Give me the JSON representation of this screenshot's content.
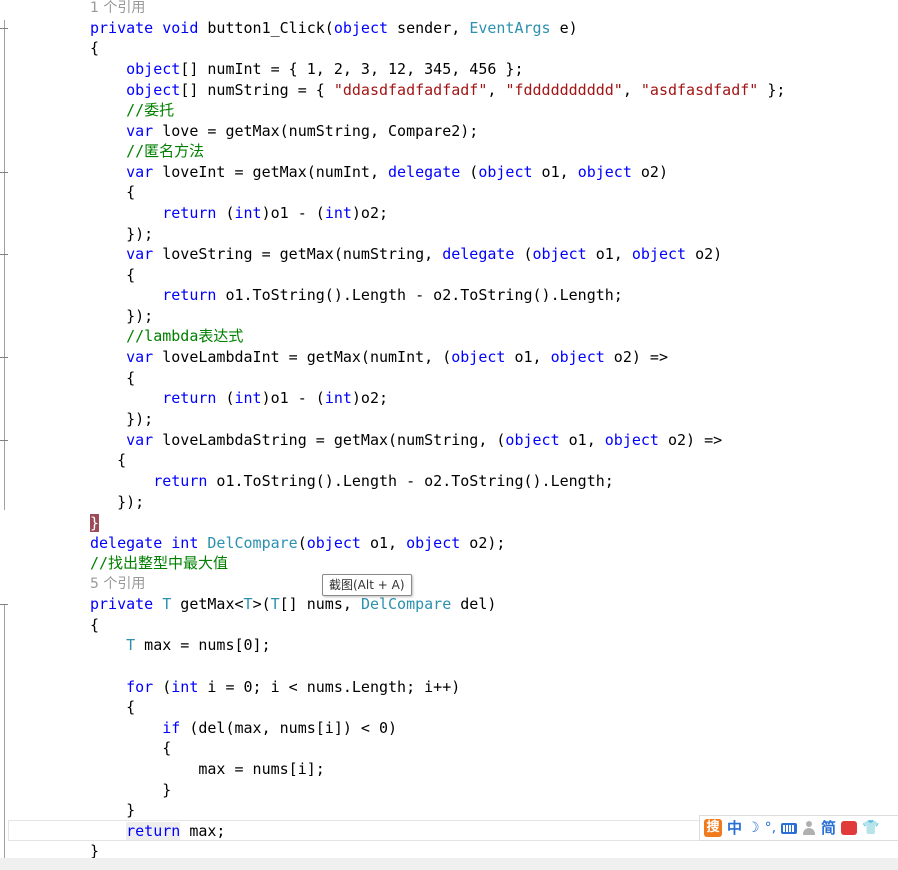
{
  "editor": {
    "codelens": [
      "1 个引用",
      "5 个引用"
    ],
    "tooltip": "截图(Alt + A)"
  },
  "ime_toolbar": {
    "logo": "搜",
    "lang": "中",
    "moon": "☽",
    "punct": "°,",
    "mode": "简",
    "shirt": "👕"
  },
  "code": {
    "l0": [
      "private",
      " ",
      "void",
      " button1_Click(",
      "object",
      " sender, ",
      "EventArgs",
      " e)"
    ],
    "l1": [
      "{"
    ],
    "l2": [
      "    ",
      "object",
      "[] numInt = { 1, 2, 3, 12, 345, 456 };"
    ],
    "l3": [
      "    ",
      "object",
      "[] numString = { ",
      "\"ddasdfadfadfadf\"",
      ", ",
      "\"fdddddddddd\"",
      ", ",
      "\"asdfasdfadf\"",
      " };"
    ],
    "l4": [
      "    ",
      "//委托"
    ],
    "l5": [
      "    ",
      "var",
      " love = getMax(numString, Compare2);"
    ],
    "l6": [
      "    ",
      "//匿名方法"
    ],
    "l7": [
      "    ",
      "var",
      " loveInt = getMax(numInt, ",
      "delegate",
      " (",
      "object",
      " o1, ",
      "object",
      " o2)"
    ],
    "l8": [
      "    {"
    ],
    "l9": [
      "        ",
      "return",
      " (",
      "int",
      ")o1 - (",
      "int",
      ")o2;"
    ],
    "l10": [
      "    });"
    ],
    "l11": [
      "    ",
      "var",
      " loveString = getMax(numString, ",
      "delegate",
      " (",
      "object",
      " o1, ",
      "object",
      " o2)"
    ],
    "l12": [
      "    {"
    ],
    "l13": [
      "        ",
      "return",
      " o1.ToString().Length - o2.ToString().Length;"
    ],
    "l14": [
      "    });"
    ],
    "l15": [
      "    ",
      "//lambda表达式"
    ],
    "l16": [
      "    ",
      "var",
      " loveLambdaInt = getMax(numInt, (",
      "object",
      " o1, ",
      "object",
      " o2) =>"
    ],
    "l17": [
      "    {"
    ],
    "l18": [
      "        ",
      "return",
      " (",
      "int",
      ")o1 - (",
      "int",
      ")o2;"
    ],
    "l19": [
      "    });"
    ],
    "l20": [
      "    ",
      "var",
      " loveLambdaString = getMax(numString, (",
      "object",
      " o1, ",
      "object",
      " o2) =>"
    ],
    "l21": [
      "   {"
    ],
    "l22": [
      "       ",
      "return",
      " o1.ToString().Length - o2.ToString().Length;"
    ],
    "l23": [
      "   });"
    ],
    "l24": [
      "}"
    ],
    "l25": [
      "delegate",
      " ",
      "int",
      " ",
      "DelCompare",
      "(",
      "object",
      " o1, ",
      "object",
      " o2);"
    ],
    "l26": [
      "//找出整型中最大值"
    ],
    "l27": [
      "private",
      " ",
      "T",
      " getMax<",
      "T",
      ">(",
      "T",
      "[] nums, ",
      "DelCompare",
      " del)"
    ],
    "l28": [
      "{"
    ],
    "l29": [
      "    ",
      "T",
      " max = nums[0];"
    ],
    "l30": [
      ""
    ],
    "l31": [
      "    ",
      "for",
      " (",
      "int",
      " i = 0; i < nums.Length; i++)"
    ],
    "l32": [
      "    {"
    ],
    "l33": [
      "        ",
      "if",
      " (del(max, nums[i]) < 0)"
    ],
    "l34": [
      "        {"
    ],
    "l35": [
      "            max = nums[i];"
    ],
    "l36": [
      "        }"
    ],
    "l37": [
      "    }"
    ],
    "l38": [
      "    ",
      "return",
      " max;"
    ],
    "l39": [
      "}"
    ]
  },
  "colors": {
    "keyword": "#0000ff",
    "type": "#2b91af",
    "string": "#a31515",
    "comment": "#008000",
    "text": "#000000",
    "codelens": "#999999",
    "brace_highlight": "#9b4c58"
  }
}
